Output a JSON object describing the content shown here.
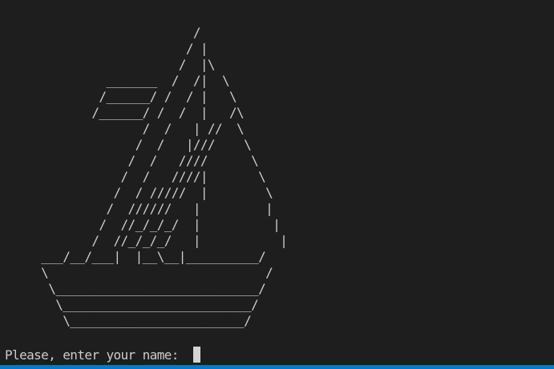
{
  "terminal": {
    "background": "#1e1e1e",
    "foreground": "#cccccc",
    "cursor_color": "#d4d4d4"
  },
  "art": {
    "sailboat": "                          /\n                         / |\n                        /  |\\\n              _______  /  /|  \\\n             /______/ /  / |   \\\n            /______/ /  /  |   /\\\n                   /  /   | //  \\\n                  /  /   |///    \\\n                 /  /   ////      \\\n                /  /   ////|       \\\n               /  / /////  |        \\\n              /  //////   |         |\n             /  //_/_/_/  |          |\n            /  //_/_/_/   |           |\n     ___/__/___|  |__\\__|__________/\n     \\                              /\n      \\____________________________/\n       \\__________________________/\n        \\________________________/"
  },
  "prompt": {
    "label": "Please, enter your name: ",
    "input_value": ""
  },
  "status_bar": {
    "color": "#007acc"
  }
}
